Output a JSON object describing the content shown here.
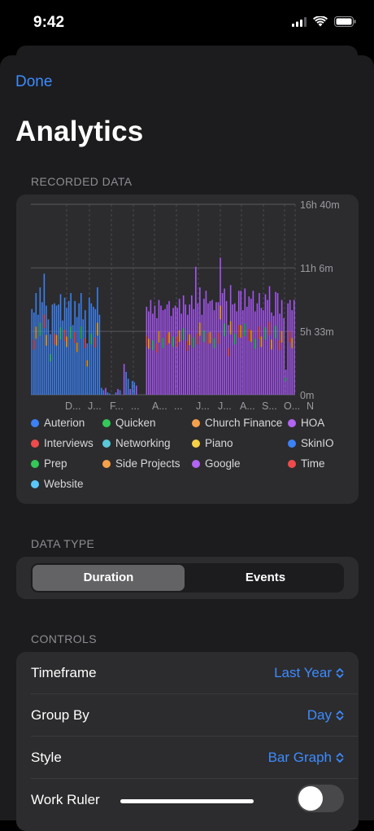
{
  "status": {
    "time": "9:42"
  },
  "nav": {
    "done_label": "Done"
  },
  "page": {
    "title": "Analytics"
  },
  "sections": {
    "recorded_data": "RECORDED DATA",
    "data_type": "DATA TYPE",
    "controls": "CONTROLS"
  },
  "chart_data": {
    "type": "bar",
    "stacked": true,
    "title": "",
    "y_tick_labels": [
      "0m",
      "5h 33m",
      "11h 6m",
      "16h 40m"
    ],
    "y_ticks_hours": [
      0,
      5.55,
      11.1,
      16.67
    ],
    "ylim_hours": [
      0,
      16.67
    ],
    "x_tick_labels": [
      "D...",
      "J...",
      "F...",
      "...",
      "A...",
      "...",
      "J...",
      "J...",
      "A...",
      "S...",
      "O...",
      "N"
    ],
    "grid": true,
    "daily_totals_hours": [
      7.5,
      7.2,
      8.9,
      7.0,
      9.4,
      8.1,
      10.6,
      7.8,
      6.6,
      5.3,
      7.9,
      8.0,
      7.8,
      7.9,
      8.8,
      6.5,
      8.5,
      7.6,
      8.2,
      8.9,
      6.1,
      8.2,
      6.8,
      8.0,
      8.9,
      6.6,
      7.4,
      4.5,
      8.5,
      8.0,
      7.7,
      7.5,
      9.4,
      7.0,
      0.6,
      0.4,
      0.6,
      0.2,
      0.1,
      0,
      0,
      0.2,
      0.5,
      0.4,
      0,
      2.7,
      2.0,
      1.4,
      0.5,
      1.2,
      1.1,
      0.8,
      0,
      0,
      0,
      0,
      7.7,
      7.3,
      8.3,
      7.1,
      7.8,
      6.7,
      8.3,
      7.8,
      7.4,
      7.5,
      7.9,
      8.2,
      6.9,
      7.6,
      7.8,
      7.6,
      8.4,
      7.1,
      8.7,
      7.9,
      7.0,
      7.9,
      8.7,
      7.5,
      11.2,
      8.0,
      9.4,
      7.0,
      8.4,
      9.1,
      8.0,
      8.2,
      8.3,
      7.4,
      8.1,
      8.1,
      12.0,
      8.9,
      9.3,
      8.2,
      6.1,
      9.6,
      7.9,
      8.0,
      7.3,
      9.1,
      9.1,
      7.4,
      9.3,
      7.7,
      8.6,
      8.4,
      9.1,
      7.3,
      8.0,
      8.9,
      7.6,
      7.4,
      8.8,
      8.3,
      9.5,
      7.2,
      6.9,
      9.0,
      8.9,
      7.1,
      8.3,
      6.7,
      2.2,
      8.0,
      8.3,
      7.4,
      8.3
    ],
    "series_colors_by_segment": [
      "#3b82f6",
      "#a855f7",
      "#ef4444",
      "#22c55e",
      "#f59e0b"
    ],
    "legend": [
      {
        "name": "Auterion",
        "color": "#3b82f6"
      },
      {
        "name": "Quicken",
        "color": "#34c759"
      },
      {
        "name": "Church Finance",
        "color": "#f6a04b"
      },
      {
        "name": "HOA",
        "color": "#b264f2"
      },
      {
        "name": "Interviews",
        "color": "#ef4b4b"
      },
      {
        "name": "Networking",
        "color": "#5ac8d8"
      },
      {
        "name": "Piano",
        "color": "#f7d046"
      },
      {
        "name": "SkinIO",
        "color": "#3b82f6"
      },
      {
        "name": "Prep",
        "color": "#34c759"
      },
      {
        "name": "Side Projects",
        "color": "#f6a04b"
      },
      {
        "name": "Google",
        "color": "#b264f2"
      },
      {
        "name": "Time",
        "color": "#ef4b4b"
      },
      {
        "name": "Website",
        "color": "#5ac8fa"
      }
    ]
  },
  "data_type": {
    "options": [
      "Duration",
      "Events"
    ],
    "selected": "Duration"
  },
  "controls": {
    "timeframe": {
      "label": "Timeframe",
      "value": "Last Year"
    },
    "group_by": {
      "label": "Group By",
      "value": "Day"
    },
    "style": {
      "label": "Style",
      "value": "Bar Graph"
    },
    "work_ruler": {
      "label": "Work Ruler",
      "enabled": false
    }
  },
  "colors": {
    "accent": "#3d8bff",
    "sheet_background": "#1c1c1e",
    "card_background": "#2c2c2e"
  },
  "icons": [
    "signal-icon",
    "wifi-icon",
    "battery-icon",
    "chevron-up-down-icon"
  ]
}
